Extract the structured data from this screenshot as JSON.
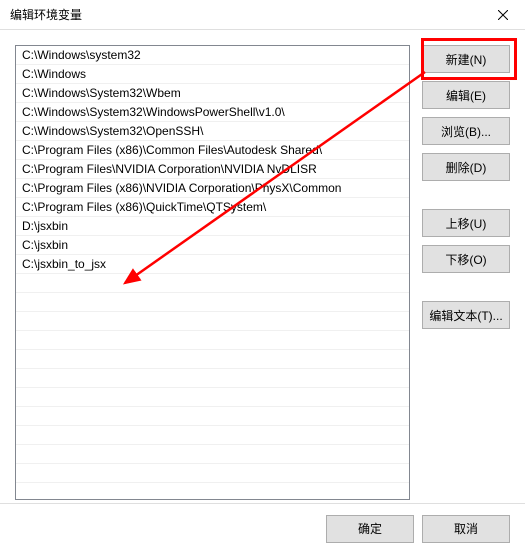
{
  "window": {
    "title": "编辑环境变量"
  },
  "list": {
    "items": [
      "C:\\Windows\\system32",
      "C:\\Windows",
      "C:\\Windows\\System32\\Wbem",
      "C:\\Windows\\System32\\WindowsPowerShell\\v1.0\\",
      "C:\\Windows\\System32\\OpenSSH\\",
      "C:\\Program Files (x86)\\Common Files\\Autodesk Shared\\",
      "C:\\Program Files\\NVIDIA Corporation\\NVIDIA NvDLISR",
      "C:\\Program Files (x86)\\NVIDIA Corporation\\PhysX\\Common",
      "C:\\Program Files (x86)\\QuickTime\\QTSystem\\",
      "D:\\jsxbin",
      "C:\\jsxbin",
      "C:\\jsxbin_to_jsx"
    ]
  },
  "buttons": {
    "new": "新建(N)",
    "edit": "编辑(E)",
    "browse": "浏览(B)...",
    "delete": "删除(D)",
    "moveUp": "上移(U)",
    "moveDown": "下移(O)",
    "editText": "编辑文本(T)...",
    "ok": "确定",
    "cancel": "取消"
  },
  "annotation": {
    "highlight_rect": true,
    "arrow_from_new_to_last_item": true
  }
}
